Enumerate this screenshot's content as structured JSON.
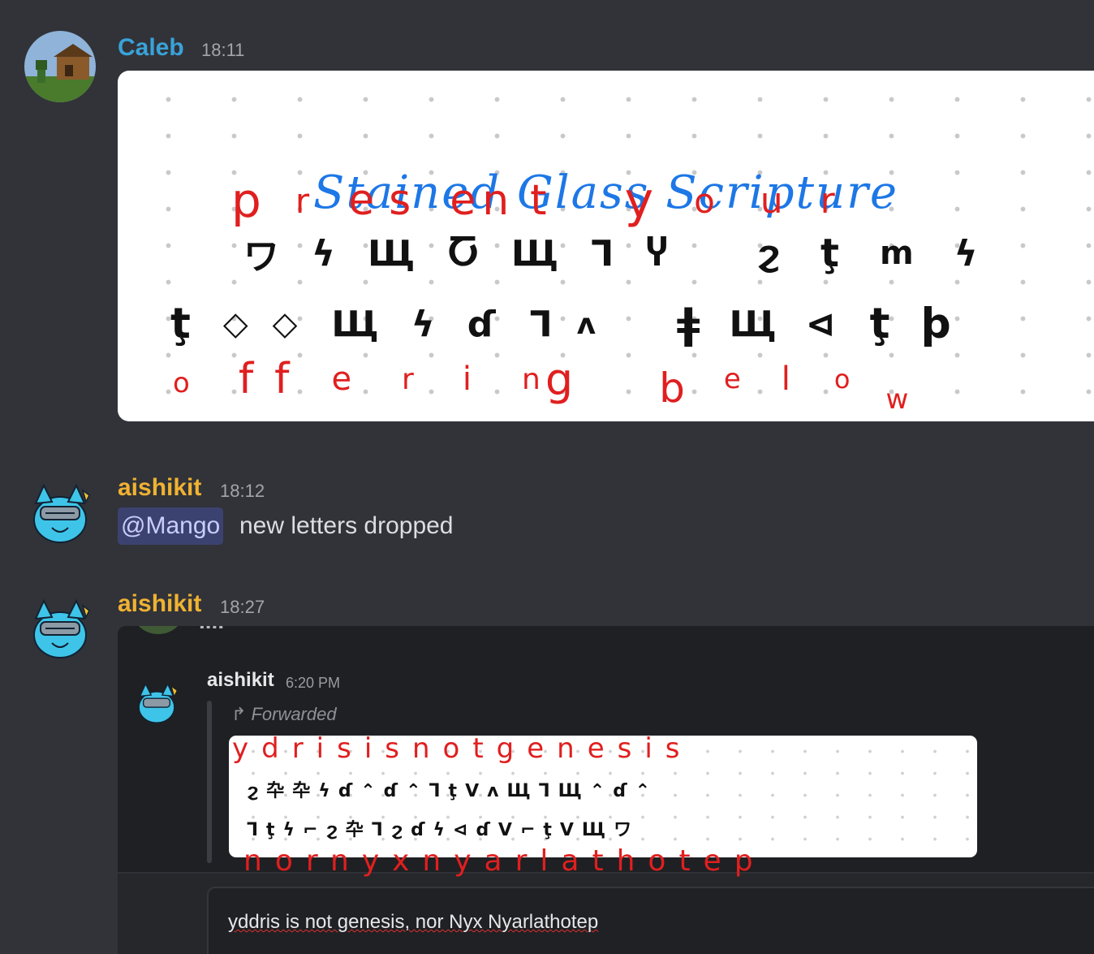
{
  "messages": [
    {
      "username": "Caleb",
      "time": "18:11",
      "username_color": "#3aa2d9",
      "image": {
        "title": "Stained Glass Scripture",
        "row1_latin": [
          "p",
          "r",
          "e",
          "s",
          "e",
          "n",
          "t",
          "y",
          "o",
          "u",
          "r"
        ],
        "row1_glyphs": [
          "ワ",
          "ϟ",
          "Щ",
          "Ⴀ",
          "Щ",
          "Ꞁ",
          "Ⴤ",
          "ϩ",
          "ţ",
          "ⅿ",
          "ϟ"
        ],
        "row2_glyphs": [
          "ţ",
          "◇",
          "◇",
          "Щ",
          "ϟ",
          "ɗ",
          "Ꞁ",
          "ʌ",
          "ǂ",
          "Щ",
          "⊲",
          "ţ",
          "ϸ"
        ],
        "row2_latin": [
          "o",
          "f",
          "f",
          "e",
          "r",
          "i",
          "n",
          "g",
          "b",
          "e",
          "l",
          "o",
          "w"
        ]
      }
    },
    {
      "username": "aishikit",
      "time": "18:12",
      "username_color": "#f0b232",
      "mention": "@Mango",
      "text": "new letters dropped"
    },
    {
      "username": "aishikit",
      "time": "18:27",
      "username_color": "#f0b232",
      "forward": {
        "cut_text": "....",
        "username": "aishikit",
        "time": "6:20 PM",
        "forwarded_label": "Forwarded",
        "image": {
          "top_latin": "ydrisisnotgenesis",
          "glyph_row1": "ϩ卆卆ϟɗ⌃ɗ⌃ꞀţⴸʌЩꞀЩ⌃ɗ⌃",
          "glyph_row2": "Ꞁţϟ⌐ϩ卆Ꞁϩɗϟ⊲ɗⴸ⌐ţⴸЩワ",
          "bottom_latin": "nornyxnyarlathotep"
        },
        "input_text": "yddris is not genesis, nor Nyx Nyarlathotep"
      }
    }
  ]
}
